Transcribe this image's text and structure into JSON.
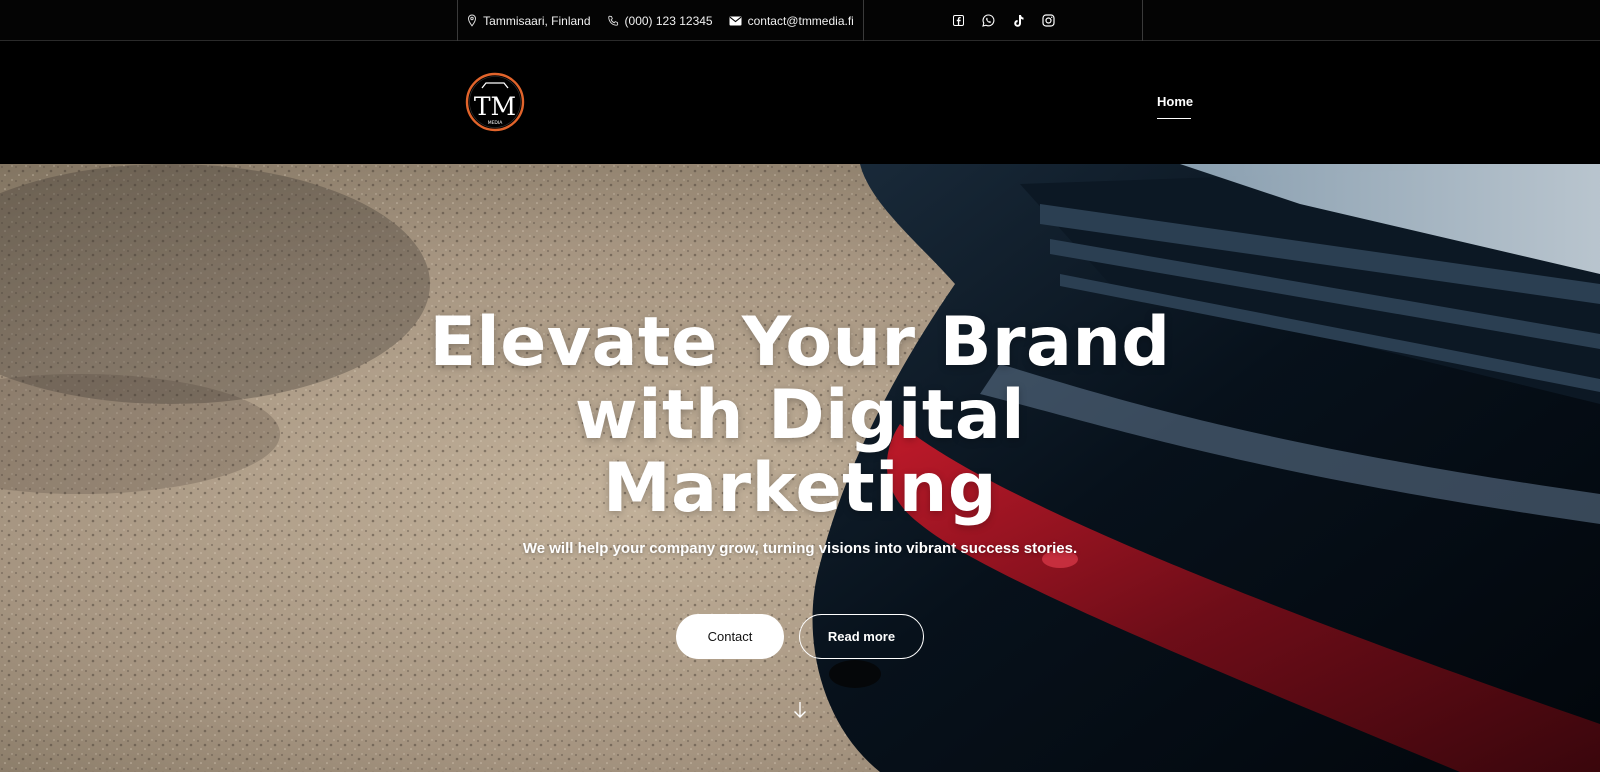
{
  "topbar": {
    "location": {
      "icon": "map-pin-icon",
      "text": "Tammisaari, Finland"
    },
    "phone": {
      "icon": "phone-icon",
      "text": "(000) 123 12345"
    },
    "email": {
      "icon": "envelope-icon",
      "text": "contact@tmmedia.fi"
    },
    "social": [
      {
        "name": "facebook-icon"
      },
      {
        "name": "whatsapp-icon"
      },
      {
        "name": "tiktok-icon"
      },
      {
        "name": "instagram-icon"
      }
    ]
  },
  "header": {
    "logo": {
      "text": "TM",
      "subtext": "MEDIA",
      "ring_color": "#e2642b"
    },
    "nav": [
      {
        "label": "Home",
        "active": true
      }
    ]
  },
  "hero": {
    "title_lines": [
      "Elevate Your Brand",
      "with Digital",
      "Marketing"
    ],
    "subtitle": "We will help your company grow, turning visions into vibrant success stories.",
    "buttons": {
      "contact": "Contact",
      "read_more": "Read more"
    },
    "scroll_icon": "arrow-down-icon"
  },
  "colors": {
    "background": "#000000",
    "accent": "#e2642b",
    "text": "#ffffff",
    "gravel": "#a99a86",
    "car_body": "#0b1622",
    "tail_light": "#8e1222"
  }
}
